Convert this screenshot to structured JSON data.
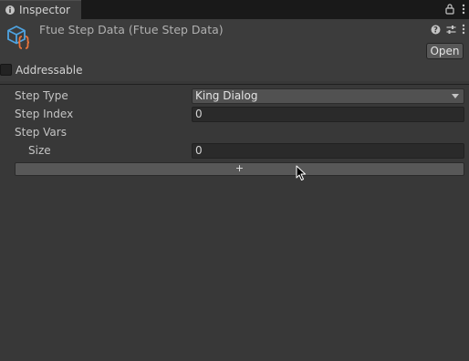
{
  "tab": {
    "title": "Inspector",
    "icon": "info-icon"
  },
  "header": {
    "title": "Ftue Step Data (Ftue Step Data)",
    "icon": "scriptable-object-icon",
    "open_label": "Open"
  },
  "addressable": {
    "label": "Addressable",
    "checked": false
  },
  "properties": {
    "step_type": {
      "label": "Step Type",
      "value": "King Dialog"
    },
    "step_index": {
      "label": "Step Index",
      "value": "0"
    },
    "step_vars": {
      "label": "Step Vars"
    },
    "size": {
      "label": "Size",
      "value": "0"
    },
    "add_label": "+"
  },
  "colors": {
    "background": "#383838",
    "header": "#3c3c3c",
    "tabbar": "#191919",
    "field": "#2a2a2a",
    "button": "#585858",
    "icon_blue": "#4ea3e0",
    "icon_orange": "#e8743b"
  }
}
